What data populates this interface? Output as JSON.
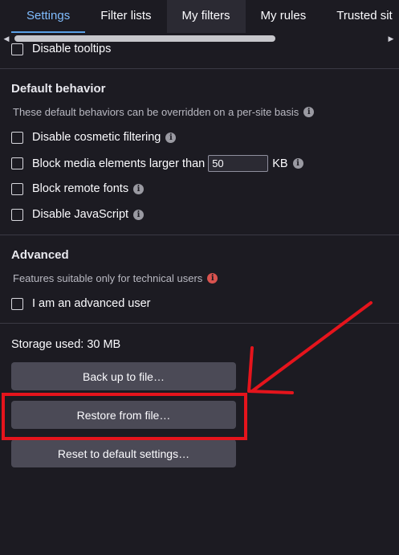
{
  "tabs": [
    {
      "label": "Settings"
    },
    {
      "label": "Filter lists"
    },
    {
      "label": "My filters"
    },
    {
      "label": "My rules"
    },
    {
      "label": "Trusted sit"
    }
  ],
  "appearance": {
    "disable_tooltips": "Disable tooltips"
  },
  "default_behavior": {
    "heading": "Default behavior",
    "description": "These default behaviors can be overridden on a per-site basis",
    "disable_cosmetic": "Disable cosmetic filtering",
    "block_media": "Block media elements larger than",
    "block_media_value": "50",
    "block_media_unit": "KB",
    "block_fonts": "Block remote fonts",
    "disable_js": "Disable JavaScript"
  },
  "advanced": {
    "heading": "Advanced",
    "description": "Features suitable only for technical users",
    "advanced_user": "I am an advanced user"
  },
  "storage": {
    "used": "Storage used: 30 MB",
    "backup": "Back up to file…",
    "restore": "Restore from file…",
    "reset": "Reset to default settings…"
  },
  "colors": {
    "background": "#1c1b22",
    "active_tab": "#80bdff",
    "annotation": "#e5141c",
    "info_red": "#d9534f"
  }
}
